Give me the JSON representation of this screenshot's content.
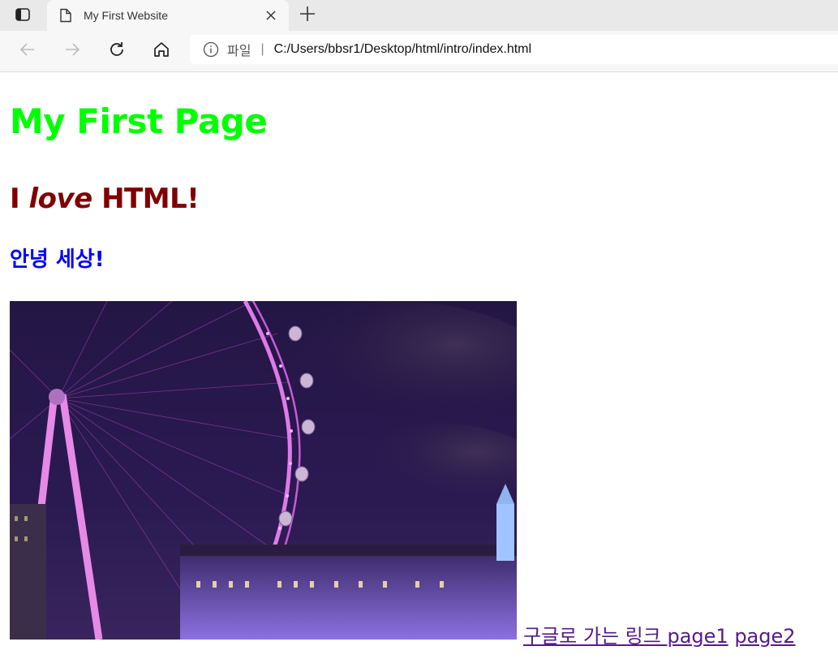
{
  "browser": {
    "tab_title": "My First Website",
    "site_label": "파일",
    "separator": "|",
    "url": "C:/Users/bbsr1/Desktop/html/intro/index.html"
  },
  "page": {
    "heading1": "My First Page",
    "heading2_before": "I ",
    "heading2_em": "love",
    "heading2_after": " HTML!",
    "heading3": "안녕 세상!",
    "links": [
      {
        "text": "구글로 가는 링크 "
      },
      {
        "text": "page1"
      },
      {
        "text": "page2"
      }
    ]
  },
  "colors": {
    "heading1": "#00ff00",
    "heading2": "#800000",
    "heading3": "#0000ff",
    "visited_link": "#551a8b"
  },
  "icons": {
    "tab_actions": "tab-actions-icon",
    "page": "page-icon",
    "close": "close-icon",
    "new_tab": "plus-icon",
    "back": "back-arrow-icon",
    "forward": "forward-arrow-icon",
    "refresh": "refresh-icon",
    "home": "home-icon",
    "info": "info-icon"
  }
}
